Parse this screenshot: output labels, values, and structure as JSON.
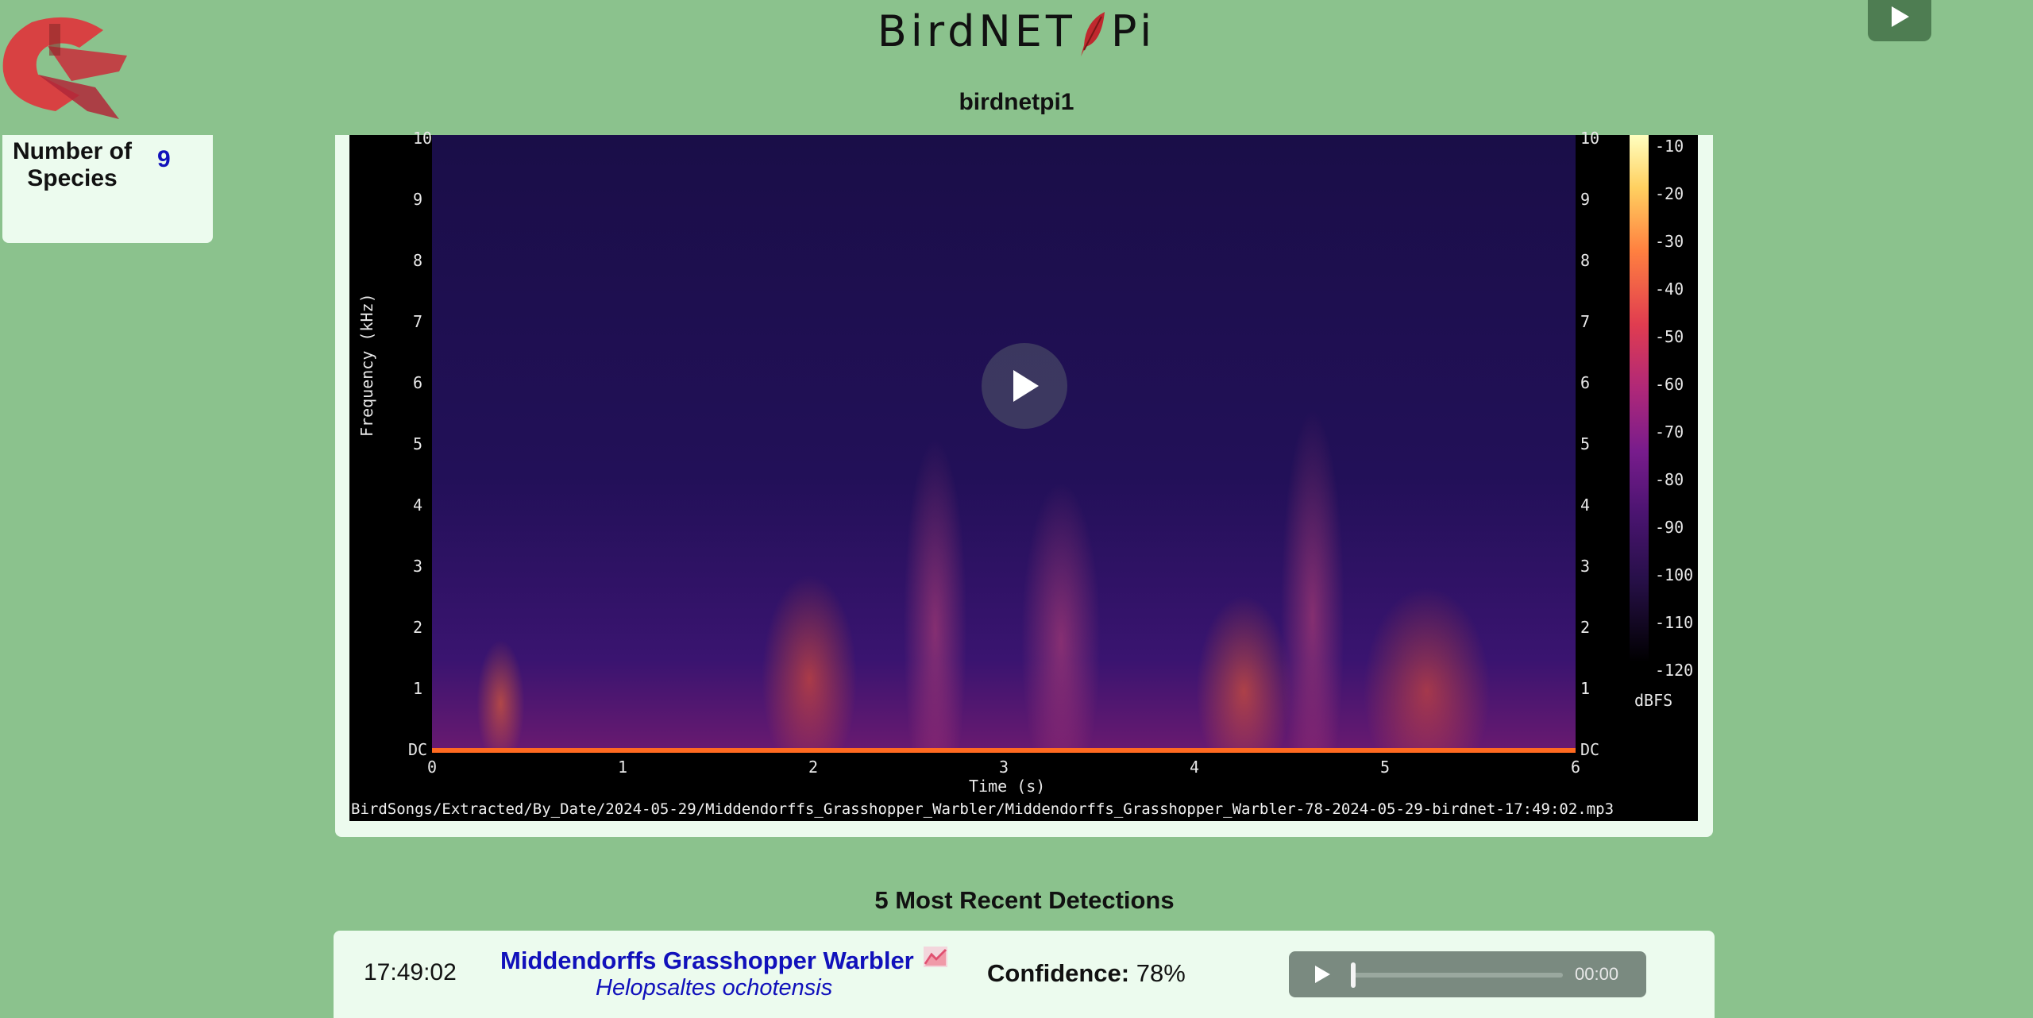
{
  "header": {
    "brand": "BirdNET",
    "brand_suffix": "Pi",
    "hostname": "birdnetpi1"
  },
  "stats": {
    "label": "Total Number of Species",
    "value": "9"
  },
  "spectrogram": {
    "caption": "BirdSongs/Extracted/By_Date/2024-05-29/Middendorffs_Grasshopper_Warbler/Middendorffs_Grasshopper_Warbler-78-2024-05-29-birdnet-17:49:02.mp3",
    "y_label": "Frequency (kHz)",
    "x_label": "Time (s)",
    "y_ticks": [
      "10",
      "9",
      "8",
      "7",
      "6",
      "5",
      "4",
      "3",
      "2",
      "1",
      "DC"
    ],
    "x_ticks": [
      "0",
      "1",
      "2",
      "3",
      "4",
      "5",
      "6"
    ],
    "colorbar_ticks": [
      "-10",
      "-20",
      "-30",
      "-40",
      "-50",
      "-60",
      "-70",
      "-80",
      "-90",
      "-100",
      "-110",
      "-120"
    ],
    "colorbar_unit": "dBFS"
  },
  "recent": {
    "title": "5 Most Recent Detections",
    "items": [
      {
        "time": "17:49:02",
        "common_name": "Middendorffs Grasshopper Warbler",
        "scientific_name": "Helopsaltes ochotensis",
        "confidence_label": "Confidence:",
        "confidence": "78%",
        "player_time": "00:00",
        "player_progress": 0
      }
    ]
  },
  "icons": [
    "logo-icon",
    "feather-icon",
    "play-icon",
    "chart-icon"
  ]
}
